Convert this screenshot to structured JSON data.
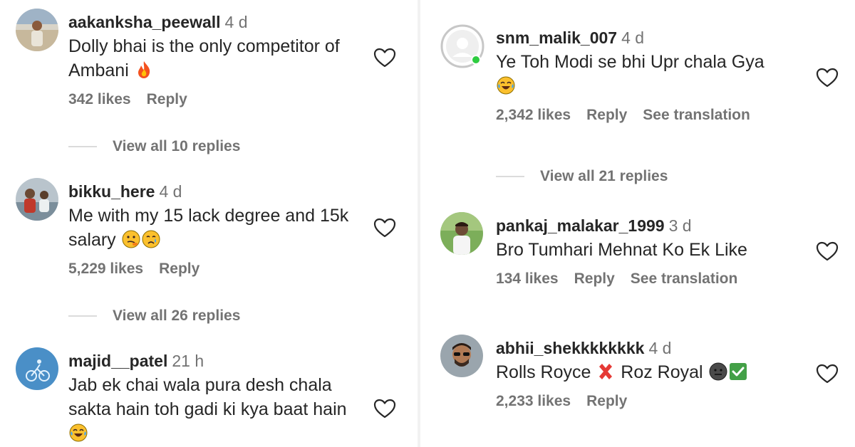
{
  "left_panel": {
    "comments": [
      {
        "username": "aakanksha_peewall",
        "time": "4 d",
        "text_lines": [
          "Dolly bhai is the only competitor of",
          "Ambani"
        ],
        "emoji": "fire-emoji",
        "likes": "342 likes",
        "reply": "Reply",
        "view_replies": "View all 10 replies"
      },
      {
        "username": "bikku_here",
        "time": "4 d",
        "text_lines": [
          "Me with my 15 lack degree and 15k",
          "salary"
        ],
        "emoji": "thinking-crying-emoji",
        "likes": "5,229 likes",
        "reply": "Reply",
        "view_replies": "View all 26 replies"
      },
      {
        "username": "majid__patel",
        "time": "21 h",
        "text_lines": [
          "Jab ek chai wala pura desh chala",
          "sakta hain toh gadi ki kya baat hain"
        ],
        "emoji": "laughing-tears-emoji"
      }
    ]
  },
  "right_panel": {
    "comments": [
      {
        "username": "snm_malik_007",
        "time": "4 d",
        "text_lines": [
          "Ye Toh Modi se bhi Upr chala Gya"
        ],
        "emoji": "laughing-tears-emoji",
        "likes": "2,342 likes",
        "reply": "Reply",
        "translation": "See translation",
        "view_replies": "View all 21 replies"
      },
      {
        "username": "pankaj_malakar_1999",
        "time": "3 d",
        "text_lines": [
          "Bro Tumhari Mehnat Ko Ek Like"
        ],
        "likes": "134 likes",
        "reply": "Reply",
        "translation": "See translation"
      },
      {
        "username": "abhii_shekkkkkkkk",
        "time": "4 d",
        "text_prefix": "Rolls Royce",
        "text_middle": "Roz Royal",
        "emoji": "cross-mark-emoji, dark-face-emoji, check-mark-emoji",
        "likes": "2,233 likes",
        "reply": "Reply"
      }
    ]
  },
  "colors": {
    "text": "#262626",
    "muted": "#737373",
    "divider": "#dbdbdb",
    "online": "#2ecc40"
  }
}
